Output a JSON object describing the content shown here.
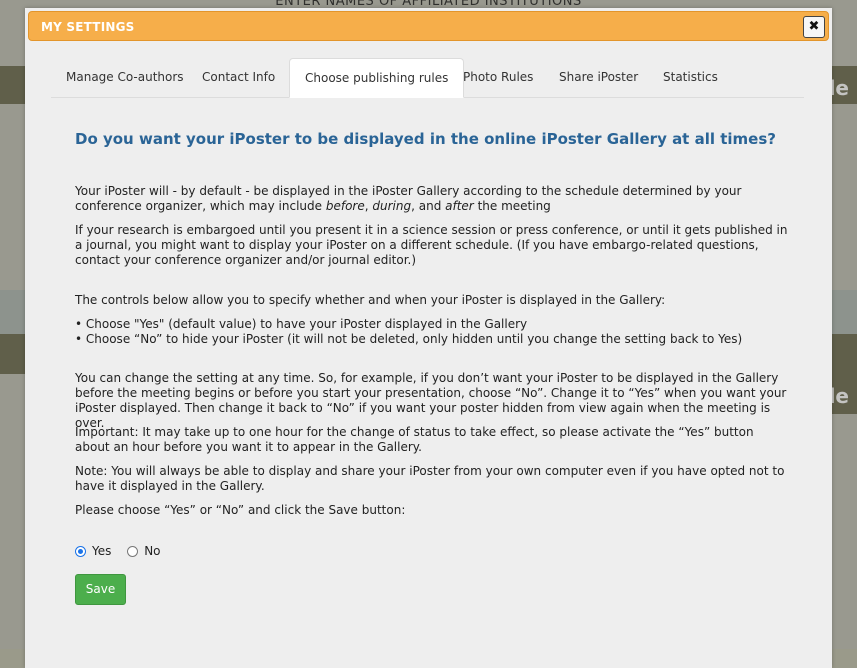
{
  "background": {
    "heading": "ENTER NAMES OF AFFILIATED INSTITUTIONS",
    "side_text_1": "le",
    "side_text_2": "le"
  },
  "dialog": {
    "title": "MY SETTINGS",
    "close_icon": "✖",
    "close_icon_name": "close-icon"
  },
  "tabs": [
    {
      "label": "Manage Co-authors",
      "active": false
    },
    {
      "label": "Contact Info",
      "active": false
    },
    {
      "label": "Choose publishing rules",
      "active": true
    },
    {
      "label": "Photo Rules",
      "active": false
    },
    {
      "label": "Share iPoster",
      "active": false
    },
    {
      "label": "Statistics",
      "active": false
    }
  ],
  "content": {
    "question": "Do you want your iPoster to be displayed in the online iPoster Gallery at all times?",
    "p1_a": "Your iPoster will - by default - be displayed in the iPoster Gallery according to the schedule determined by your conference organizer, which may include ",
    "p1_before": "before",
    "p1_sep1": ", ",
    "p1_during": "during",
    "p1_sep2": ", and ",
    "p1_after": "after",
    "p1_end": " the meeting",
    "p2": "If your research is embargoed until you present it in a science session or press conference, or until it gets published in a journal, you might want to display your iPoster on a different schedule. (If you have embargo-related questions, contact your conference organizer and/or journal editor.)",
    "p3": "The controls below allow you to specify whether and when your iPoster is displayed in the Gallery:",
    "bullet1": "• Choose \"Yes\" (default value) to have your iPoster displayed in the Gallery",
    "bullet2": "• Choose “No” to hide your iPoster (it will not be deleted, only hidden until you change the setting back to Yes)",
    "p4": "You can change the setting at any time. So, for example, if you don’t want your iPoster to be displayed in the Gallery before the meeting begins or before you start your presentation, choose “No”. Change it to “Yes” when you want your iPoster displayed. Then change it back to “No” if you want your poster hidden from view again when the meeting is over.",
    "p5": "Important: It may take up to one hour for the change of status to take effect, so please activate the “Yes” button about an hour before you want it to appear in the Gallery.",
    "p6": "Note: You will always be able to display and share your iPoster from your own computer even if you have opted not to have it displayed in the Gallery.",
    "p7": "Please choose “Yes” or “No” and click the Save button:"
  },
  "form": {
    "options": [
      {
        "label": "Yes",
        "checked": true
      },
      {
        "label": "No",
        "checked": false
      }
    ],
    "save_label": "Save"
  }
}
